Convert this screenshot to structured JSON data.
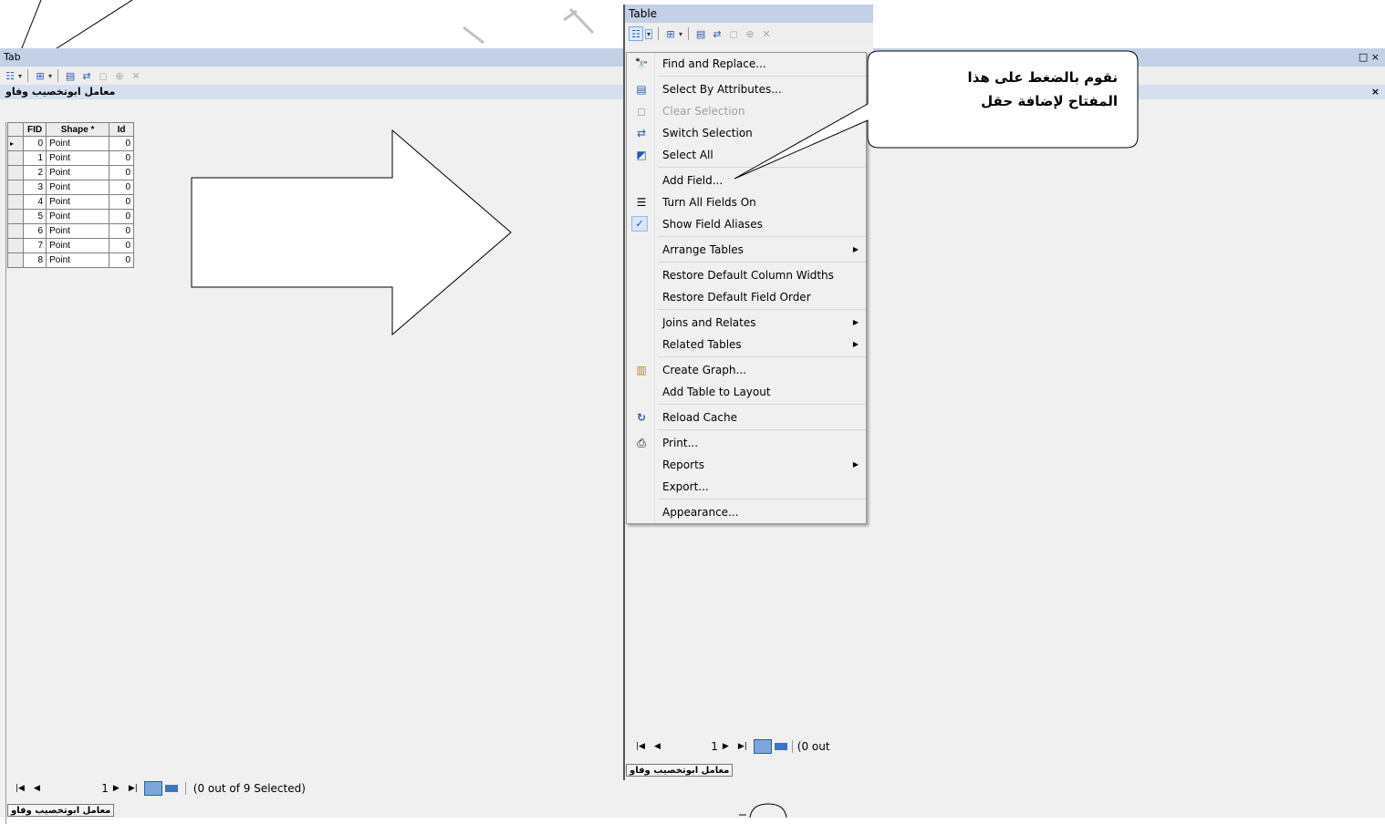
{
  "left_window": {
    "title": "Tab",
    "tab_title": "معامل ابوتخصيب وفاو",
    "columns": [
      "FID",
      "Shape *",
      "Id"
    ],
    "rows": [
      {
        "fid": "0",
        "shape": "Point",
        "id": "0"
      },
      {
        "fid": "1",
        "shape": "Point",
        "id": "0"
      },
      {
        "fid": "2",
        "shape": "Point",
        "id": "0"
      },
      {
        "fid": "3",
        "shape": "Point",
        "id": "0"
      },
      {
        "fid": "4",
        "shape": "Point",
        "id": "0"
      },
      {
        "fid": "5",
        "shape": "Point",
        "id": "0"
      },
      {
        "fid": "6",
        "shape": "Point",
        "id": "0"
      },
      {
        "fid": "7",
        "shape": "Point",
        "id": "0"
      },
      {
        "fid": "8",
        "shape": "Point",
        "id": "0"
      }
    ],
    "nav": {
      "record": "1",
      "status": "(0 out of 9 Selected)"
    },
    "bottom_tab": "معامل ابوتخصيب وفاو",
    "window_controls": "□ ×",
    "close_glyph": "×"
  },
  "right_window": {
    "title": "Table",
    "nav": {
      "record": "1",
      "status_partial": "(0 out"
    },
    "bottom_tab": "معامل ابوتخصيب وفاو"
  },
  "menu": {
    "items": [
      {
        "label": "Find and Replace...",
        "icon": "binoculars-icon",
        "glyph": "🔭"
      },
      {
        "label": "Select By Attributes...",
        "icon": "select-by-attributes-icon",
        "glyph": "▤"
      },
      {
        "label": "Clear Selection",
        "icon": "clear-selection-icon",
        "glyph": "◻",
        "disabled": true
      },
      {
        "label": "Switch Selection",
        "icon": "switch-selection-icon",
        "glyph": "⇄"
      },
      {
        "label": "Select All",
        "icon": "select-all-icon",
        "glyph": "◩"
      },
      {
        "label": "Add Field...",
        "icon": "",
        "glyph": ""
      },
      {
        "label": "Turn All Fields On",
        "icon": "fields-list-icon",
        "glyph": "☰"
      },
      {
        "label": "Show Field Aliases",
        "icon": "checkmark-icon",
        "glyph": "✓",
        "checked": true
      },
      {
        "label": "Arrange Tables",
        "submenu": true
      },
      {
        "label": "Restore Default Column Widths"
      },
      {
        "label": "Restore Default Field Order"
      },
      {
        "label": "Joins and Relates",
        "submenu": true
      },
      {
        "label": "Related Tables",
        "submenu": true
      },
      {
        "label": "Create Graph...",
        "icon": "bar-chart-icon",
        "glyph": "▥"
      },
      {
        "label": "Add Table to Layout"
      },
      {
        "label": "Reload Cache",
        "icon": "refresh-icon",
        "glyph": "↻"
      },
      {
        "label": "Print...",
        "icon": "printer-icon",
        "glyph": "⎙"
      },
      {
        "label": "Reports",
        "submenu": true
      },
      {
        "label": "Export..."
      },
      {
        "label": "Appearance..."
      }
    ]
  },
  "callout": {
    "line1": "نقوم بالضغط على هذا",
    "line2": "المفتاح لإضافة حقل"
  }
}
